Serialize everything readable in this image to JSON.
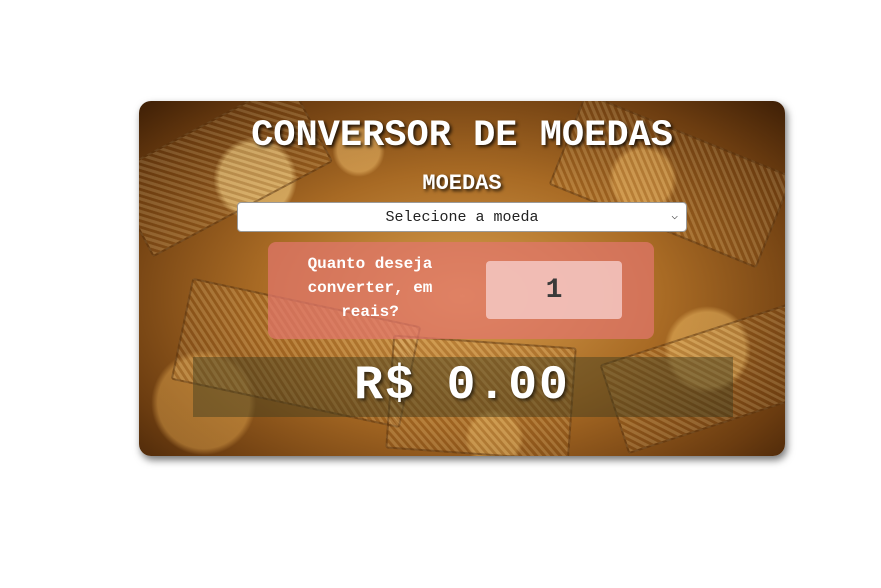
{
  "app": {
    "title": "CONVERSOR DE MOEDAS",
    "subtitle": "MOEDAS"
  },
  "currency_select": {
    "selected": "Selecione a moeda"
  },
  "converter": {
    "question": "Quanto deseja converter, em reais?",
    "amount": "1"
  },
  "result": {
    "text": "R$ 0.00"
  },
  "icons": {
    "dropdown": "chevron-down-icon"
  },
  "colors": {
    "panel": "#e2766c",
    "text": "#ffffff"
  }
}
